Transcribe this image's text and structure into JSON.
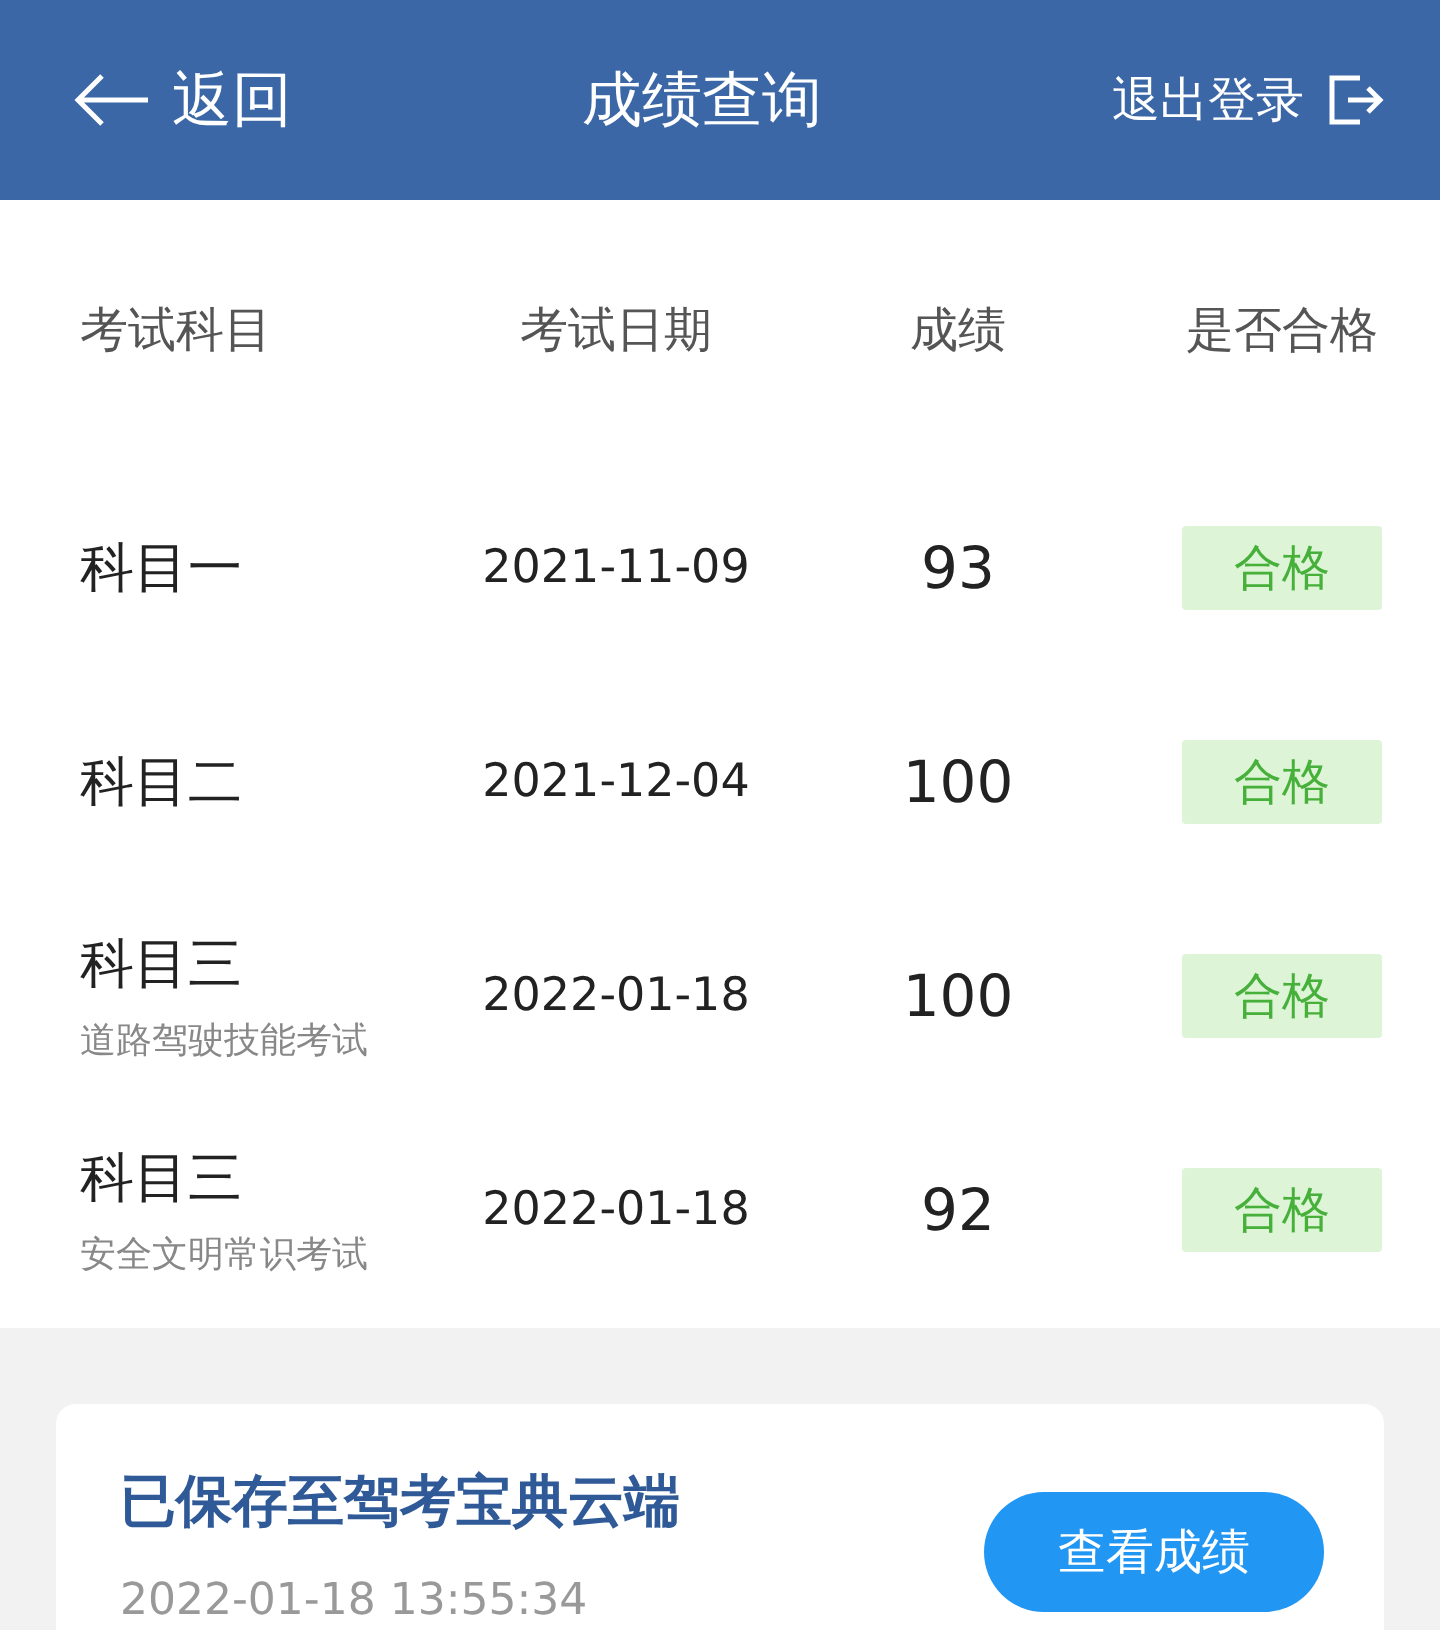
{
  "header": {
    "back": "返回",
    "title": "成绩查询",
    "logout": "退出登录"
  },
  "table": {
    "columns": [
      "考试科目",
      "考试日期",
      "成绩",
      "是否合格"
    ],
    "rows": [
      {
        "subject": "科目一",
        "date": "2021-11-09",
        "score": "93",
        "result": "合格",
        "passed": true
      },
      {
        "subject": "科目二",
        "date": "2021-12-04",
        "score": "100",
        "result": "合格",
        "passed": true
      },
      {
        "subject": "科目三",
        "subtitle": "道路驾驶技能考试",
        "date": "2022-01-18",
        "score": "100",
        "result": "合格",
        "passed": true
      },
      {
        "subject": "科目三",
        "subtitle": "安全文明常识考试",
        "date": "2022-01-18",
        "score": "92",
        "result": "合格",
        "passed": true
      }
    ]
  },
  "cloud_card": {
    "title": "已保存至驾考宝典云端",
    "time": "2022-01-18 13:55:34",
    "button": "查看成绩"
  }
}
